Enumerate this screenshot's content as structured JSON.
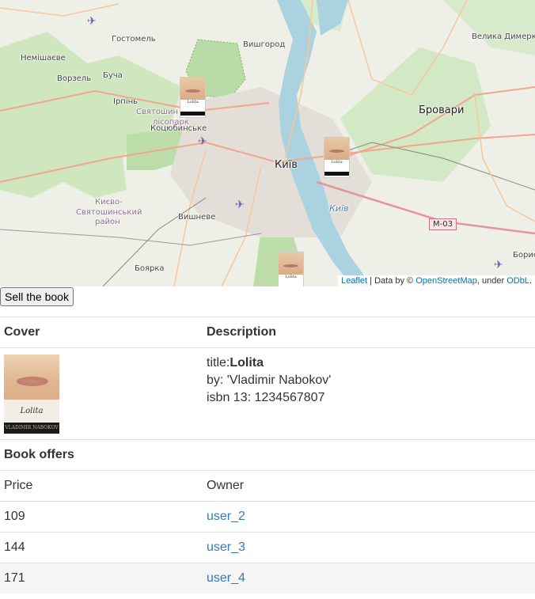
{
  "map": {
    "places": {
      "hostomel": "Гостомель",
      "vyshhorod": "Вишгород",
      "nemishaieve": "Немішаєве",
      "vorzel": "Ворзель",
      "bucha": "Буча",
      "irpin": "Ірпінь",
      "sviatoshyn_forest": "Святошин",
      "lisopark": "лісопарк",
      "kotsiubynske": "Коцюбинське",
      "brovary": "Бровари",
      "velyka_dymerka": "Велика Димерка",
      "kyiv": "Київ",
      "kyiv_river": "Київ",
      "district_line1": "Києво-",
      "district_line2": "Святошинський",
      "district_line3": "район",
      "vyshneve": "Вишневе",
      "boiarka": "Боярка",
      "boryspil": "Борис"
    },
    "road_badge": "М-03",
    "attribution": {
      "leaflet": "Leaflet",
      "sep": " | Data by © ",
      "osm": "OpenStreetMap",
      "under": ", under ",
      "odbl": "ODbL",
      "end": "."
    },
    "marker_title": "Lolita"
  },
  "sell_button": "Sell the book",
  "table": {
    "headers": {
      "cover": "Cover",
      "description": "Description"
    },
    "book": {
      "title_label": "title:",
      "title": "Lolita",
      "by": "by: 'Vladimir Nabokov'",
      "isbn": "isbn 13: 1234567807",
      "cover_title": "Lolita",
      "cover_author": "VLADIMIR NABOKOV"
    },
    "offers_heading": "Book offers",
    "offers_columns": {
      "price": "Price",
      "owner": "Owner"
    },
    "offers": [
      {
        "price": "109",
        "owner": "user_2"
      },
      {
        "price": "144",
        "owner": "user_3"
      },
      {
        "price": "171",
        "owner": "user_4"
      }
    ]
  }
}
